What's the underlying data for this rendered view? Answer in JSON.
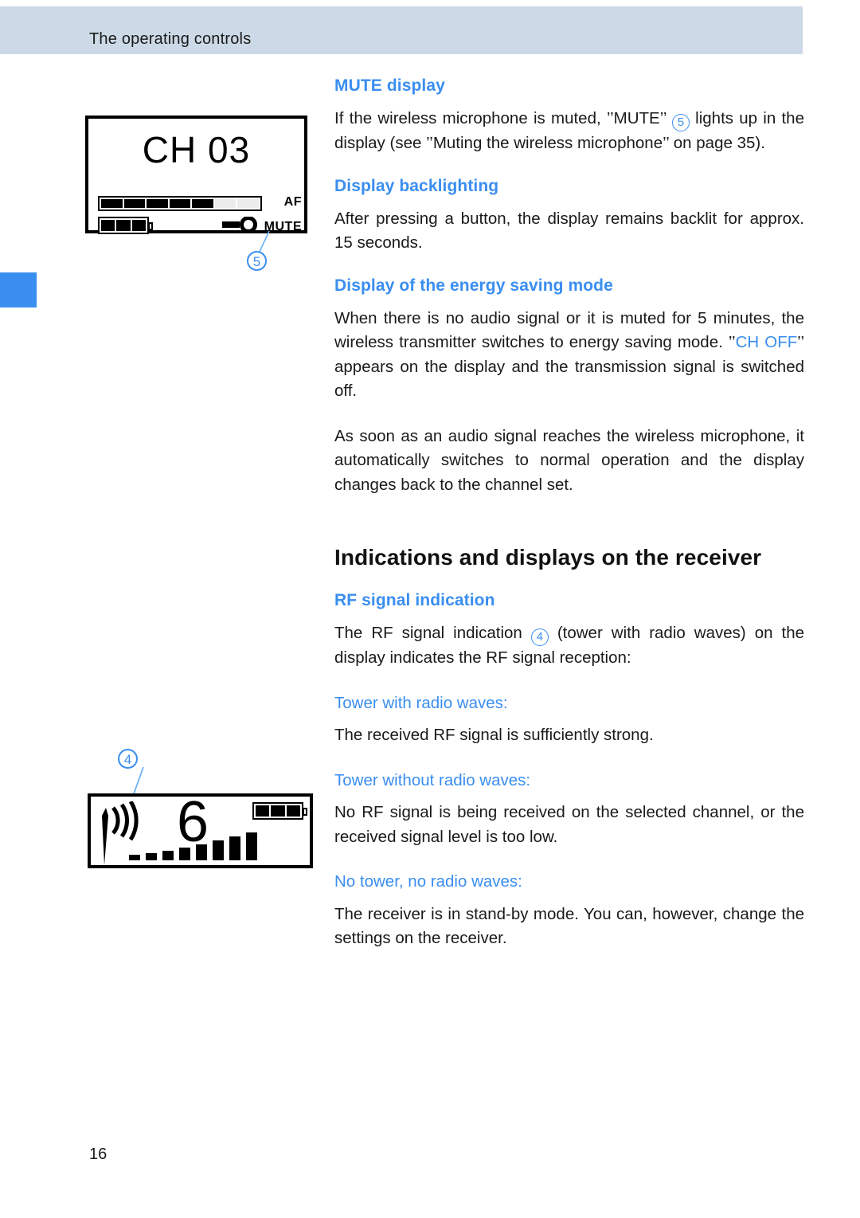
{
  "header": {
    "title": "The operating controls"
  },
  "footer": {
    "page_number": "16"
  },
  "colors": {
    "accent_blue": "#3a8ef0",
    "header_bar": "#ccd9e6",
    "text": "#1a1a1a"
  },
  "figures": {
    "transmitter_display": {
      "channel_text": "CH 03",
      "af_label": "AF",
      "mute_label": "MUTE",
      "af_segments_on": 5,
      "af_segments_off": 2,
      "battery_cells": 3,
      "callout_number": "5"
    },
    "receiver_display": {
      "channel_number": "6",
      "signal_bars": 8,
      "battery_cells": 3,
      "radio_wave_arcs": 3,
      "callout_number": "4"
    }
  },
  "content": {
    "mute_heading": "MUTE display",
    "mute_body_1": "If the wireless microphone is muted, ’’MUTE’’",
    "mute_callout": "5",
    "mute_body_2": "lights up in the display (see ’’Muting the wireless microphone’’ on page 35).",
    "backlight_heading": "Display backlighting",
    "backlight_body": "After pressing a button, the display remains backlit for approx. 15  seconds.",
    "energy_heading": "Display of the energy saving mode",
    "energy_body_1": "When there is no audio signal or it is muted for 5 minutes, the wireless transmitter switches to energy saving mode. ’’",
    "energy_highlight": "CH OFF",
    "energy_body_2": "’’ appears on the display and the transmission signal is switched off.",
    "energy_body_3": "As soon as an audio signal reaches the wireless microphone, it automatically switches to normal operation and the display changes back to the channel set.",
    "receiver_heading": "Indications and displays on the receiver",
    "rf_heading": "RF signal indication",
    "rf_body_1": "The RF signal indication",
    "rf_callout": "4",
    "rf_body_2": "(tower with radio waves) on the display indicates the RF signal reception:",
    "tower_with_label": "Tower with radio waves:",
    "tower_with_body": "The received RF signal is sufficiently strong.",
    "tower_without_label": "Tower without radio waves:",
    "tower_without_body": "No RF signal is being received on the selected channel, or the received signal level is too low.",
    "no_tower_label": "No tower, no radio waves:",
    "no_tower_body": "The receiver is in stand-by mode. You can, however, change the settings on the receiver."
  }
}
